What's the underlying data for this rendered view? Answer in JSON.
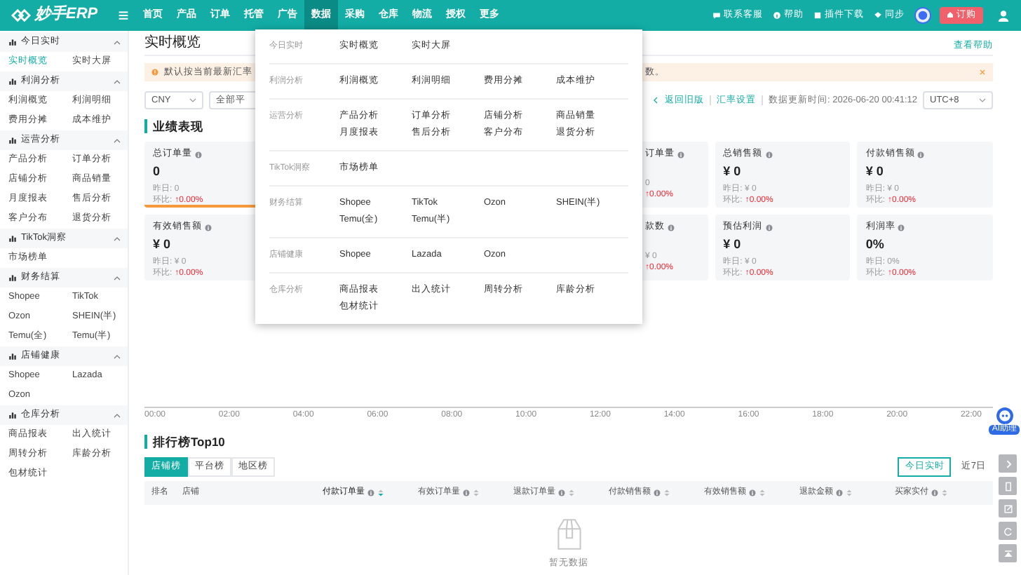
{
  "brand": {
    "name": "妙手ERP"
  },
  "nav": [
    {
      "label": "首页",
      "selected": false
    },
    {
      "label": "产品",
      "selected": false
    },
    {
      "label": "订单",
      "selected": false
    },
    {
      "label": "托管",
      "selected": false
    },
    {
      "label": "广告",
      "selected": false
    },
    {
      "label": "数据",
      "selected": true
    },
    {
      "label": "采购",
      "selected": false
    },
    {
      "label": "仓库",
      "selected": false
    },
    {
      "label": "物流",
      "selected": false
    },
    {
      "label": "授权",
      "selected": false
    },
    {
      "label": "更多",
      "selected": false
    }
  ],
  "header_actions": [
    {
      "label": "联系客服"
    },
    {
      "label": "帮助"
    },
    {
      "label": "插件下载"
    },
    {
      "label": "同步"
    }
  ],
  "order_button": "订购",
  "sidebar": [
    {
      "title": "今日实时",
      "expanded": true,
      "items": [
        {
          "label": "实时概览",
          "selected": true
        },
        {
          "label": "实时大屏",
          "selected": false
        }
      ]
    },
    {
      "title": "利润分析",
      "expanded": true,
      "items": [
        {
          "label": "利润概览",
          "selected": false
        },
        {
          "label": "利润明细",
          "selected": false
        },
        {
          "label": "费用分摊",
          "selected": false
        },
        {
          "label": "成本维护",
          "selected": false
        }
      ]
    },
    {
      "title": "运营分析",
      "expanded": true,
      "items": [
        {
          "label": "产品分析",
          "selected": false
        },
        {
          "label": "订单分析",
          "selected": false
        },
        {
          "label": "店铺分析",
          "selected": false
        },
        {
          "label": "商品销量",
          "selected": false
        },
        {
          "label": "月度报表",
          "selected": false
        },
        {
          "label": "售后分析",
          "selected": false
        },
        {
          "label": "客户分布",
          "selected": false
        },
        {
          "label": "退货分析",
          "selected": false
        }
      ]
    },
    {
      "title": "TikTok洞察",
      "expanded": true,
      "items": [
        {
          "label": "市场榜单",
          "selected": false
        }
      ]
    },
    {
      "title": "财务结算",
      "expanded": true,
      "items": [
        {
          "label": "Shopee",
          "selected": false
        },
        {
          "label": "TikTok",
          "selected": false
        },
        {
          "label": "Ozon",
          "selected": false
        },
        {
          "label": "SHEIN(半)",
          "selected": false
        },
        {
          "label": "Temu(全)",
          "selected": false
        },
        {
          "label": "Temu(半)",
          "selected": false
        }
      ]
    },
    {
      "title": "店铺健康",
      "expanded": true,
      "items": [
        {
          "label": "Shopee",
          "selected": false
        },
        {
          "label": "Lazada",
          "selected": false
        },
        {
          "label": "Ozon",
          "selected": false
        }
      ]
    },
    {
      "title": "仓库分析",
      "expanded": true,
      "items": [
        {
          "label": "商品报表",
          "selected": false
        },
        {
          "label": "出入统计",
          "selected": false
        },
        {
          "label": "周转分析",
          "selected": false
        },
        {
          "label": "库龄分析",
          "selected": false
        },
        {
          "label": "包材统计",
          "selected": false
        }
      ]
    }
  ],
  "dropdown": [
    {
      "title": "今日实时",
      "items": [
        "实时概览",
        "实时大屏"
      ]
    },
    {
      "title": "利润分析",
      "items": [
        "利润概览",
        "利润明细",
        "费用分摊",
        "成本维护"
      ]
    },
    {
      "title": "运营分析",
      "items": [
        "产品分析",
        "订单分析",
        "店铺分析",
        "商品销量",
        "月度报表",
        "售后分析",
        "客户分布",
        "退货分析"
      ]
    },
    {
      "title": "TikTok洞察",
      "items": [
        "市场榜单"
      ]
    },
    {
      "title": "财务结算",
      "items": [
        "Shopee",
        "TikTok",
        "Ozon",
        "SHEIN(半)",
        "Temu(全)",
        "Temu(半)"
      ]
    },
    {
      "title": "店铺健康",
      "items": [
        "Shopee",
        "Lazada",
        "Ozon"
      ]
    },
    {
      "title": "仓库分析",
      "items": [
        "商品报表",
        "出入统计",
        "周转分析",
        "库龄分析",
        "包材统计"
      ]
    }
  ],
  "page": {
    "title": "实时概览",
    "help_link": "查看帮助"
  },
  "alert": {
    "text": "默认按当前最新汇率",
    "text_after": "数。"
  },
  "filters": {
    "currency": "CNY",
    "platform": "全部平",
    "back_link": "返回旧版",
    "rate_link": "汇率设置",
    "updated": "数据更新时间: 2026-06-20 00:41:12",
    "timezone": "UTC+8"
  },
  "metrics": {
    "title": "业绩表现",
    "rows": [
      {
        "cards": [
          {
            "kind": "full",
            "title": "总订单量",
            "value": "0",
            "yesterday": "昨日: 0",
            "change_label": "环比:",
            "change": "↑0.00%",
            "selected": true
          },
          {
            "kind": "cut",
            "title": "订单量",
            "yesterday": "0",
            "change": "↑0.00%",
            "selected": false
          },
          {
            "kind": "full",
            "title": "总销售额",
            "value": "¥ 0",
            "yesterday": "昨日: ¥ 0",
            "change_label": "环比:",
            "change": "↑0.00%",
            "selected": false
          },
          {
            "kind": "full",
            "title": "付款销售额",
            "value": "¥ 0",
            "yesterday": "昨日: ¥ 0",
            "change_label": "环比:",
            "change": "↑0.00%",
            "selected": false
          }
        ]
      },
      {
        "cards": [
          {
            "kind": "full",
            "title": "有效销售额",
            "value": "¥ 0",
            "yesterday": "昨日: ¥ 0",
            "change_label": "环比:",
            "change": "↑0.00%",
            "selected": false
          },
          {
            "kind": "cut",
            "title": "款数",
            "yesterday": "¥ 0",
            "change": "↑0.00%",
            "selected": false
          },
          {
            "kind": "full",
            "title": "预估利润",
            "value": "¥ 0",
            "yesterday": "昨日: ¥ 0",
            "change_label": "环比:",
            "change": "↑0.00%",
            "selected": false
          },
          {
            "kind": "full",
            "title": "利润率",
            "value": "0%",
            "yesterday": "昨日: 0%",
            "change_label": "环比:",
            "change": "↑0.00%",
            "selected": false
          }
        ]
      }
    ]
  },
  "trend_chart": {
    "xticks": [
      "00:00",
      "02:00",
      "04:00",
      "06:00",
      "08:00",
      "10:00",
      "12:00",
      "14:00",
      "16:00",
      "18:00",
      "20:00",
      "22:00"
    ]
  },
  "ranking": {
    "title": "排行榜Top10",
    "tabs": [
      {
        "label": "店铺榜",
        "selected": true
      },
      {
        "label": "平台榜",
        "selected": false
      },
      {
        "label": "地区榜",
        "selected": false
      }
    ],
    "periods": [
      {
        "label": "今日实时",
        "selected": true
      },
      {
        "label": "近7日",
        "selected": false
      }
    ],
    "columns": [
      {
        "label": "排名",
        "info": false,
        "sortable": false,
        "sorted": false
      },
      {
        "label": "店铺",
        "info": false,
        "sortable": false,
        "sorted": false
      },
      {
        "label": "付款订单量",
        "info": true,
        "sortable": true,
        "sorted": true
      },
      {
        "label": "有效订单量",
        "info": true,
        "sortable": true,
        "sorted": false
      },
      {
        "label": "退款订单量",
        "info": true,
        "sortable": true,
        "sorted": false
      },
      {
        "label": "付款销售额",
        "info": true,
        "sortable": true,
        "sorted": false
      },
      {
        "label": "有效销售额",
        "info": true,
        "sortable": true,
        "sorted": false
      },
      {
        "label": "退款金额",
        "info": true,
        "sortable": true,
        "sorted": false
      },
      {
        "label": "买家实付",
        "info": true,
        "sortable": true,
        "sorted": false
      }
    ],
    "empty_text": "暂无数据"
  },
  "assistant": {
    "label": "AI助理"
  }
}
